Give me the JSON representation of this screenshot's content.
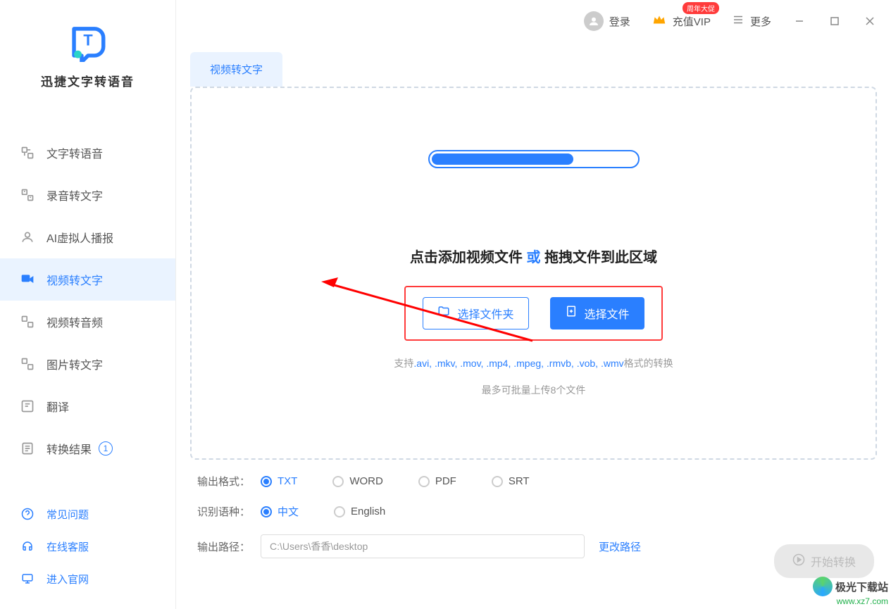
{
  "app": {
    "name": "迅捷文字转语音"
  },
  "sidebar": {
    "items": [
      {
        "label": "文字转语音"
      },
      {
        "label": "录音转文字"
      },
      {
        "label": "AI虚拟人播报"
      },
      {
        "label": "视频转文字"
      },
      {
        "label": "视频转音频"
      },
      {
        "label": "图片转文字"
      },
      {
        "label": "翻译"
      },
      {
        "label": "转换结果",
        "badge": "1"
      }
    ],
    "bottom": [
      {
        "label": "常见问题"
      },
      {
        "label": "在线客服"
      },
      {
        "label": "进入官网"
      }
    ]
  },
  "titlebar": {
    "login": "登录",
    "vip": "充值VIP",
    "vip_badge": "周年大促",
    "more": "更多"
  },
  "tabs": {
    "active": "视频转文字"
  },
  "drop": {
    "text_pre": "点击添加视频文件",
    "text_or": "或",
    "text_post": "拖拽文件到此区域",
    "btn_folder": "选择文件夹",
    "btn_file": "选择文件",
    "hint_pre": "支持",
    "hint_ext": ".avi, .mkv, .mov, .mp4, .mpeg, .rmvb, .vob, .wmv",
    "hint_post": "格式的转换",
    "hint_max": "最多可批量上传8个文件"
  },
  "settings": {
    "format_label": "输出格式：",
    "formats": [
      "TXT",
      "WORD",
      "PDF",
      "SRT"
    ],
    "format_selected": "TXT",
    "lang_label": "识别语种：",
    "langs": [
      "中文",
      "English"
    ],
    "lang_selected": "中文",
    "path_label": "输出路径：",
    "path_value": "C:\\Users\\香香\\desktop",
    "change_path": "更改路径"
  },
  "start_btn": "开始转换",
  "watermark": {
    "text": "极光下载站",
    "url": "www.xz7.com"
  }
}
